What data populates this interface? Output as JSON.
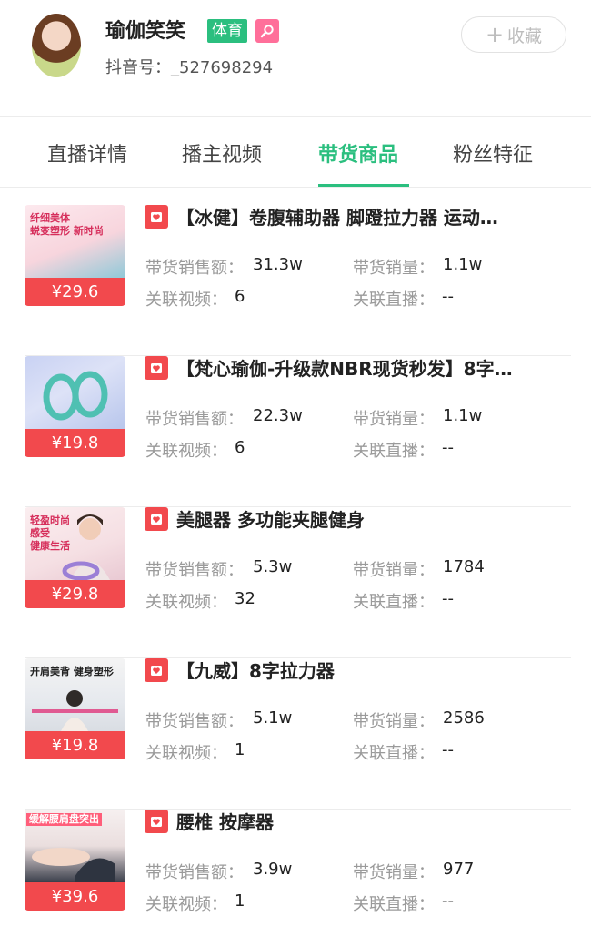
{
  "header": {
    "name": "瑜伽笑笑",
    "category_tag": "体育",
    "account_label": "抖音号：",
    "account_id": "_527698294",
    "favorite_label": "收藏"
  },
  "tabs": [
    {
      "label": "直播详情"
    },
    {
      "label": "播主视频"
    },
    {
      "label": "带货商品"
    },
    {
      "label": "粉丝特征"
    }
  ],
  "active_tab": "带货商品",
  "labels": {
    "sales_amount": "带货销售额：",
    "sales_volume": "带货销量：",
    "linked_videos": "关联视频：",
    "linked_live": "关联直播："
  },
  "products": [
    {
      "title": "【冰健】卷腹辅助器 脚蹬拉力器 运动…",
      "price": "¥29.6",
      "sales_amount": "31.3w",
      "sales_volume": "1.1w",
      "linked_videos": "6",
      "linked_live": "--",
      "img_text": "纤细美体\n蜕变塑形 新时尚"
    },
    {
      "title": "【梵心瑜伽-升级款NBR现货秒发】8字…",
      "price": "¥19.8",
      "sales_amount": "22.3w",
      "sales_volume": "1.1w",
      "linked_videos": "6",
      "linked_live": "--",
      "img_text": ""
    },
    {
      "title": "美腿器 多功能夹腿健身",
      "price": "¥29.8",
      "sales_amount": "5.3w",
      "sales_volume": "1784",
      "linked_videos": "32",
      "linked_live": "--",
      "img_text": "轻盈时尚\n感受\n健康生活"
    },
    {
      "title": "【九威】8字拉力器",
      "price": "¥19.8",
      "sales_amount": "5.1w",
      "sales_volume": "2586",
      "linked_videos": "1",
      "linked_live": "--",
      "img_text": "开肩美背 健身塑形"
    },
    {
      "title": "腰椎 按摩器",
      "price": "¥39.6",
      "sales_amount": "3.9w",
      "sales_volume": "977",
      "linked_videos": "1",
      "linked_live": "--",
      "img_text": "缓解腰肩盘突出"
    }
  ],
  "colors": {
    "accent_green": "#2bbf7f",
    "price_red": "#f2494d",
    "search_pink": "#ff6f9a"
  }
}
